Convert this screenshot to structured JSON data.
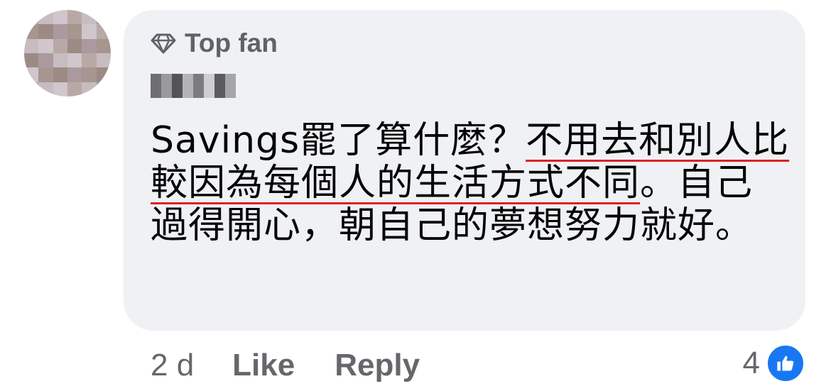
{
  "comment": {
    "badge_label": "Top fan",
    "badge_icon": "diamond-icon",
    "text_plain_1": "Savings罷了算什麼？",
    "text_underlined": "不用去和別人比較因為每個人的生活方式不同",
    "text_plain_2": "。自己過得開心，朝自己的夢想努力就好。",
    "underline_color": "#e02020"
  },
  "actions": {
    "timestamp": "2 d",
    "like_label": "Like",
    "reply_label": "Reply"
  },
  "reactions": {
    "count": "4",
    "icon": "thumbs-up-icon",
    "color": "#1877f2"
  },
  "colors": {
    "bubble_bg": "#eff1f4",
    "muted_text": "#65676b",
    "body_text": "#050505"
  }
}
